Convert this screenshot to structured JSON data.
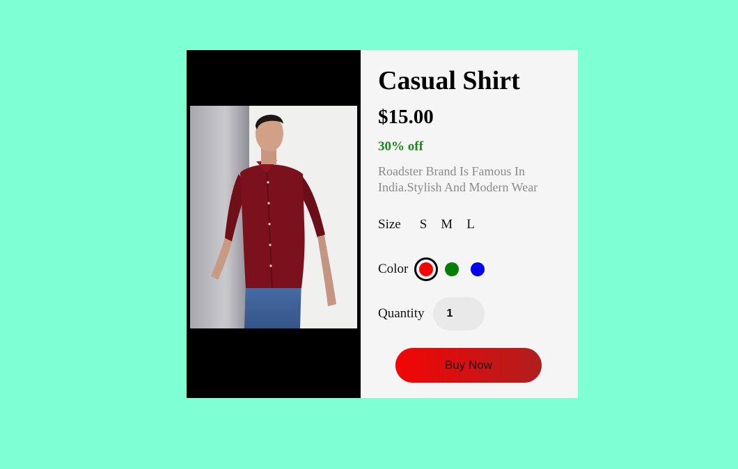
{
  "product": {
    "image_alt": "Man in maroon casual shirt and blue jeans",
    "title": "Casual Shirt",
    "price": "$15.00",
    "discount": "30% off",
    "description": "Roadster Brand Is Famous In India.Stylish And Modern Wear"
  },
  "size": {
    "label": "Size",
    "options": [
      "S",
      "M",
      "L"
    ]
  },
  "color": {
    "label": "Color",
    "options": [
      {
        "name": "red",
        "hex": "#ff0000",
        "selected": true
      },
      {
        "name": "green",
        "hex": "#008000",
        "selected": false
      },
      {
        "name": "blue",
        "hex": "#0000ff",
        "selected": false
      }
    ]
  },
  "quantity": {
    "label": "Quantity",
    "value": "1"
  },
  "buy_button": {
    "label": "Buy Now"
  },
  "colors": {
    "page_background": "#7fffd4",
    "card_background": "#f5f5f5",
    "image_panel": "#000000",
    "discount_text": "#1a8a1a",
    "button_gradient_start": "#f40505",
    "button_gradient_end": "#b01e1e"
  }
}
